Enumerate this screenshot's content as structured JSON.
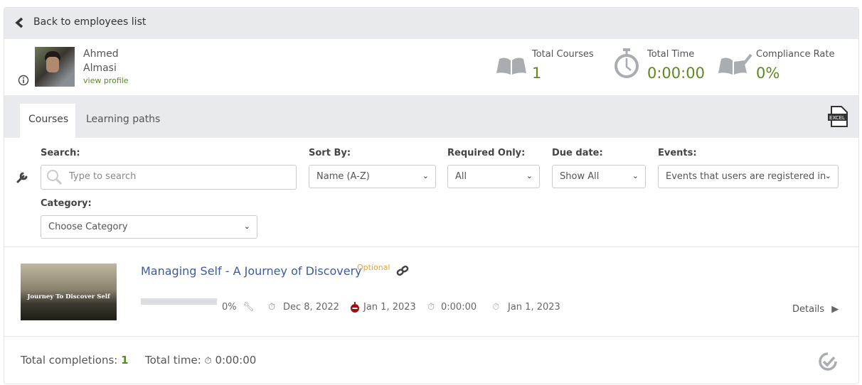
{
  "back": {
    "label": "Back to employees list",
    "icon": "chevron-left-icon"
  },
  "profile": {
    "first_name": "Ahmed",
    "last_name": "Almasi",
    "view_profile": "view profile"
  },
  "stats": [
    {
      "label": "Total Courses",
      "value": "1",
      "icon": "open-book-icon"
    },
    {
      "label": "Total Time",
      "value": "0:00:00",
      "icon": "stopwatch-icon"
    },
    {
      "label": "Compliance Rate",
      "value": "0%",
      "icon": "book-check-icon"
    }
  ],
  "tabs": [
    {
      "label": "Courses",
      "active": true
    },
    {
      "label": "Learning paths",
      "active": false
    }
  ],
  "export": {
    "label": "EXCEL"
  },
  "filters": {
    "search": {
      "label": "Search:",
      "placeholder": "Type to search"
    },
    "sort": {
      "label": "Sort By:",
      "value": "Name (A-Z)"
    },
    "required": {
      "label": "Required Only:",
      "value": "All"
    },
    "due": {
      "label": "Due date:",
      "value": "Show All"
    },
    "events": {
      "label": "Events:",
      "value": "Events that users are registered in"
    },
    "category": {
      "label": "Category:",
      "value": "Choose Category"
    }
  },
  "course": {
    "thumb_text": "Journey To Discover Self",
    "title": "Managing Self - A Journey of Discovery",
    "badge": "Optional",
    "progress_percent": 0,
    "progress_label": "0%",
    "start_date": "Dec 8, 2022",
    "due_date": "Jan 1, 2023",
    "time": "0:00:00",
    "completed_date": "Jan 1, 2023",
    "details": "Details"
  },
  "footer": {
    "completions_label": "Total completions:",
    "completions_value": "1",
    "time_label": "Total time:",
    "time_value": "0:00:00"
  },
  "colors": {
    "accent_green": "#5b8a1e",
    "link_blue": "#3d5a9e",
    "optional_orange": "#e8a33a",
    "due_red": "#a01010"
  }
}
